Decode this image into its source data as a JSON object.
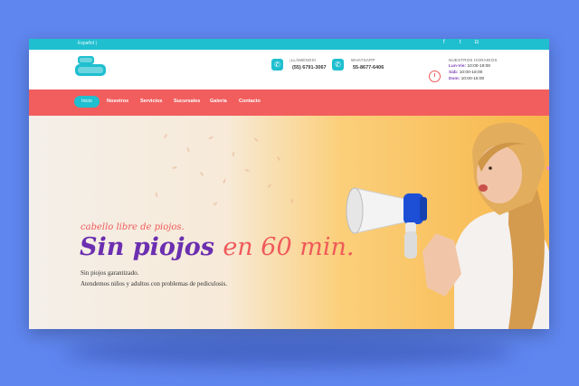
{
  "topbar": {
    "language": "Español  |",
    "social": [
      "facebook-icon",
      "twitter-icon",
      "instagram-icon"
    ]
  },
  "header": {
    "call": {
      "label": "¡LLÁMENOS!",
      "value": "(55) 6791-3067"
    },
    "whatsapp": {
      "label": "WHATSAPP",
      "value": "55-8677-6406"
    },
    "hours": {
      "label": "NUESTROS HORARIOS",
      "rows": [
        {
          "day": "Lun-Vie:",
          "time": "10:00-19:00"
        },
        {
          "day": "Sáb:",
          "time": "10:00-18:00"
        },
        {
          "day": "Dom:",
          "time": "10:00-15:00"
        }
      ]
    }
  },
  "nav": {
    "items": [
      "Inicio",
      "Nosotros",
      "Servicios",
      "Sucursales",
      "Galería",
      "Contacto"
    ]
  },
  "hero": {
    "tagline": "cabello libre de piojos.",
    "title_part1": "Sin piojos",
    "title_part2": "en 60 min.",
    "line1": "Sin piojos garantizado.",
    "line2": "Atendemos niños y adultos con problemas de pediculosis."
  },
  "colors": {
    "accent_teal": "#1fbfcf",
    "nav_red": "#f25e5e",
    "title_purple": "#6b2fb0",
    "title_red": "#ef5a5a",
    "background": "#5f86ef"
  }
}
